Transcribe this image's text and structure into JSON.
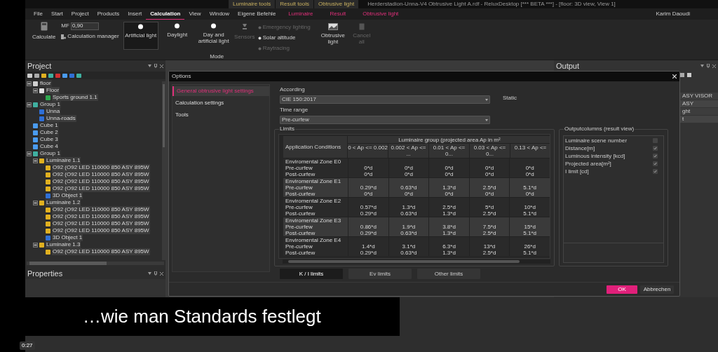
{
  "title_bar": {
    "context_tabs": [
      "Luminaire tools",
      "Result tools",
      "Obtrusive light"
    ],
    "title": "Herderstadion-Unna-V4 Obtrusive Light A.rdf - ReluxDesktop [*** BETA ***] - [floor: 3D view, View 1]"
  },
  "menu": {
    "items": [
      {
        "label": "File",
        "selected": false,
        "kind": "plain"
      },
      {
        "label": "Start",
        "selected": false,
        "kind": "plain"
      },
      {
        "label": "Project",
        "selected": false,
        "kind": "plain"
      },
      {
        "label": "Products",
        "selected": false,
        "kind": "plain"
      },
      {
        "label": "Insert",
        "selected": false,
        "kind": "plain"
      },
      {
        "label": "Calculation",
        "selected": true,
        "kind": "plain"
      },
      {
        "label": "View",
        "selected": false,
        "kind": "plain"
      },
      {
        "label": "Window",
        "selected": false,
        "kind": "plain"
      },
      {
        "label": "Eigene Befehle",
        "selected": false,
        "kind": "plain"
      },
      {
        "label": "Luminaire",
        "selected": false,
        "kind": "context"
      },
      {
        "label": "Result",
        "selected": false,
        "kind": "context"
      },
      {
        "label": "Obtrusive light",
        "selected": false,
        "kind": "context"
      }
    ],
    "user": "Karim Daoudi"
  },
  "ribbon": {
    "calculate": "Calculate",
    "mf_label": "MF",
    "mf_value": "0,90",
    "calc_manager": "Calculation manager",
    "modes": [
      {
        "label": "Artificial light",
        "selected": true
      },
      {
        "label": "Daylight",
        "selected": false
      },
      {
        "label": "Day and artificial light",
        "selected": false
      }
    ],
    "sensors": {
      "label": "Sensors",
      "disabled": true
    },
    "options": [
      {
        "label": "Emergency lighting",
        "disabled": true
      },
      {
        "label": "Solar altitude",
        "disabled": false
      },
      {
        "label": "Raytracing",
        "disabled": true
      }
    ],
    "mode_group": "Mode",
    "obtrusive": "Obtrusive light",
    "cancel": {
      "label": "Cancel all",
      "disabled": true
    }
  },
  "project": {
    "title": "Project",
    "tree": [
      {
        "label": "floor",
        "kind": "floor",
        "expanded": true,
        "children": [
          {
            "label": "Floor",
            "kind": "surface",
            "expanded": true,
            "children": [
              {
                "label": "Sports ground 1.1",
                "kind": "ground"
              }
            ]
          }
        ]
      },
      {
        "label": "Group  1",
        "kind": "group",
        "expanded": true,
        "children": [
          {
            "label": "Unna",
            "kind": "object"
          },
          {
            "label": "Unna-roads",
            "kind": "object"
          }
        ]
      },
      {
        "label": "Cube 1",
        "kind": "cube"
      },
      {
        "label": "Cube 2",
        "kind": "cube"
      },
      {
        "label": "Cube 3",
        "kind": "cube"
      },
      {
        "label": "Cube 4",
        "kind": "cube"
      },
      {
        "label": "Group  1",
        "kind": "group",
        "expanded": true,
        "children": [
          {
            "label": "Luminaire  1.1",
            "kind": "luminaire",
            "expanded": true,
            "children": [
              {
                "label": "O92 (O92 LED 110000 850 ASY 895W",
                "kind": "lamp"
              },
              {
                "label": "O92 (O92 LED 110000 850 ASY 895W",
                "kind": "lamp"
              },
              {
                "label": "O92 (O92 LED 110000 850 ASY 895W",
                "kind": "lamp"
              },
              {
                "label": "O92 (O92 LED 110000 850 ASY 895W",
                "kind": "lamp"
              },
              {
                "label": "3D Object  1",
                "kind": "object"
              }
            ]
          },
          {
            "label": "Luminaire  1.2",
            "kind": "luminaire",
            "expanded": true,
            "children": [
              {
                "label": "O92 (O92 LED 110000 850 ASY 895W",
                "kind": "lamp"
              },
              {
                "label": "O92 (O92 LED 110000 850 ASY 895W",
                "kind": "lamp"
              },
              {
                "label": "O92 (O92 LED 110000 850 ASY 895W",
                "kind": "lamp"
              },
              {
                "label": "O92 (O92 LED 110000 850 ASY 895W",
                "kind": "lamp"
              },
              {
                "label": "3D Object  1",
                "kind": "object"
              }
            ]
          },
          {
            "label": "Luminaire  1.3",
            "kind": "luminaire",
            "expanded": true,
            "children": [
              {
                "label": "O92 (O92 LED 110000 850 ASY 895W",
                "kind": "lamp"
              }
            ]
          }
        ]
      }
    ]
  },
  "properties": {
    "title": "Properties"
  },
  "output": {
    "title": "Output",
    "rows": [
      "ASY VISOR",
      "ASY",
      "ght",
      "t"
    ]
  },
  "dialog": {
    "title": "Options",
    "nav": [
      {
        "label": "General obtrusive light settings",
        "selected": true
      },
      {
        "label": "Calculation settings",
        "selected": false
      },
      {
        "label": "Tools",
        "selected": false
      }
    ],
    "according_label": "According",
    "according_value": "CIE 150:2017",
    "static": "Static",
    "time_label": "Time range",
    "time_value": "Pre-curfew",
    "limits": {
      "title": "Limits",
      "condition_header": "Application Conditions",
      "group_header": "Luminaire group (projected area Ap in m²",
      "columns": [
        "0 < Ap <= 0.002",
        "0.002 < Ap <= ...",
        "0.01 < Ap <= 0...",
        "0.03 < Ap <= 0...",
        "0.13 < Ap <="
      ],
      "rows": [
        {
          "zone": "Enviromental Zone E0",
          "pre_label": "Pre-curfew",
          "post_label": "Post-curfew",
          "pre": [
            "0*d",
            "0*d",
            "0*d",
            "0*d",
            "0*d"
          ],
          "post": [
            "0*d",
            "0*d",
            "0*d",
            "0*d",
            "0*d"
          ]
        },
        {
          "zone": "Enviromental Zone E1",
          "pre_label": "Pre-curfew",
          "post_label": "Post-curfew",
          "pre": [
            "0.29*d",
            "0.63*d",
            "1.3*d",
            "2.5*d",
            "5.1*d"
          ],
          "post": [
            "0*d",
            "0*d",
            "0*d",
            "0*d",
            "0*d"
          ]
        },
        {
          "zone": "Enviromental Zone E2",
          "pre_label": "Pre-curfew",
          "post_label": "Post-curfew",
          "pre": [
            "0.57*d",
            "1.3*d",
            "2.5*d",
            "5*d",
            "10*d"
          ],
          "post": [
            "0.29*d",
            "0.63*d",
            "1.3*d",
            "2.5*d",
            "5.1*d"
          ]
        },
        {
          "zone": "Enviromental Zone E3",
          "pre_label": "Pre-curfew",
          "post_label": "Post-curfew",
          "pre": [
            "0.86*d",
            "1.9*d",
            "3.8*d",
            "7.5*d",
            "15*d"
          ],
          "post": [
            "0.29*d",
            "0.63*d",
            "1.3*d",
            "2.5*d",
            "5.1*d"
          ]
        },
        {
          "zone": "Enviromental Zone E4",
          "pre_label": "Pre-curfew",
          "post_label": "Post-curfew",
          "pre": [
            "1.4*d",
            "3.1*d",
            "6.3*d",
            "13*d",
            "26*d"
          ],
          "post": [
            "0.29*d",
            "0.63*d",
            "1.3*d",
            "2.5*d",
            "5.1*d"
          ]
        }
      ]
    },
    "output_columns": {
      "title": "Outputcolumns (result view)",
      "items": [
        {
          "label": "Luminaire scene number",
          "checked": false
        },
        {
          "label": "Distance[m]",
          "checked": true
        },
        {
          "label": "Luminous intensity [kcd]",
          "checked": true
        },
        {
          "label": "Projected area[m²]",
          "checked": true
        },
        {
          "label": "I limit [cd]",
          "checked": true
        }
      ]
    },
    "limit_tabs": [
      {
        "label": "K / I limits",
        "selected": true
      },
      {
        "label": "Ev limits",
        "selected": false
      },
      {
        "label": "Other limits",
        "selected": false
      }
    ],
    "ok": "OK",
    "cancel": "Abbrechen"
  },
  "subtitle": "…wie man Standards festlegt",
  "time": "0:27"
}
